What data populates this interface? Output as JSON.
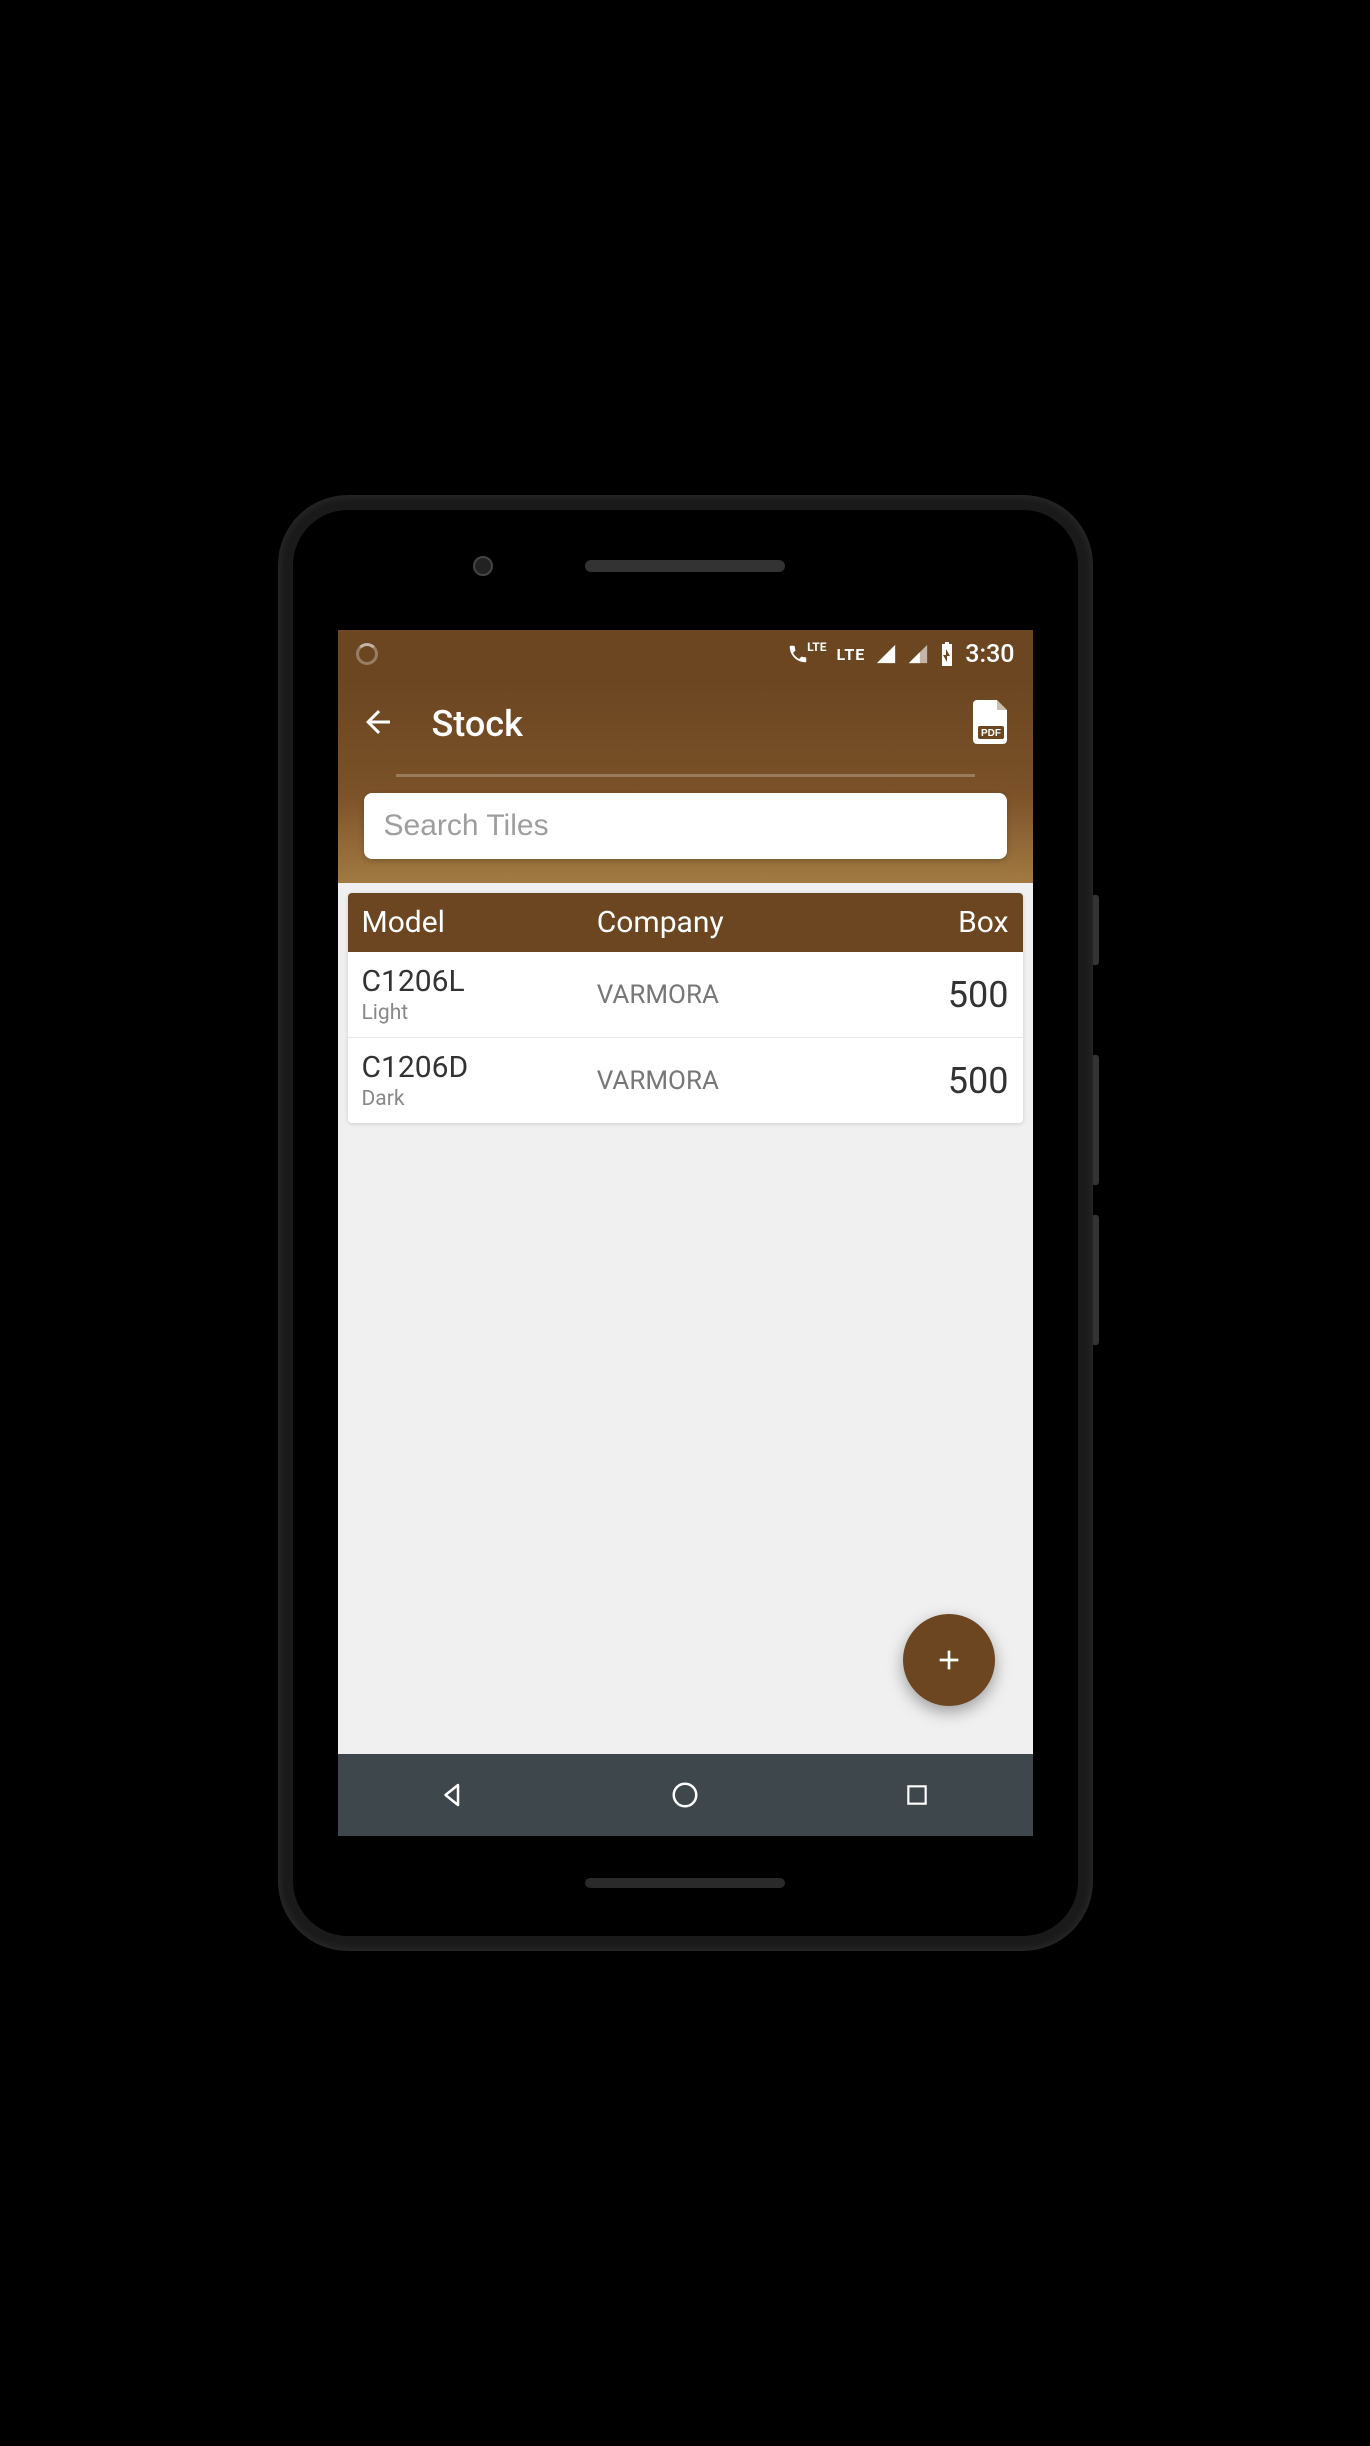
{
  "status_bar": {
    "lte_label": "LTE",
    "time": "3:30"
  },
  "header": {
    "title": "Stock"
  },
  "search": {
    "placeholder": "Search Tiles"
  },
  "table": {
    "columns": {
      "model": "Model",
      "company": "Company",
      "box": "Box"
    },
    "rows": [
      {
        "model": "C1206L",
        "variant": "Light",
        "company": "VARMORA",
        "box": "500"
      },
      {
        "model": "C1206D",
        "variant": "Dark",
        "company": "VARMORA",
        "box": "500"
      }
    ]
  },
  "colors": {
    "primary": "#6b4621",
    "accent_gradient_end": "#a27a42"
  }
}
